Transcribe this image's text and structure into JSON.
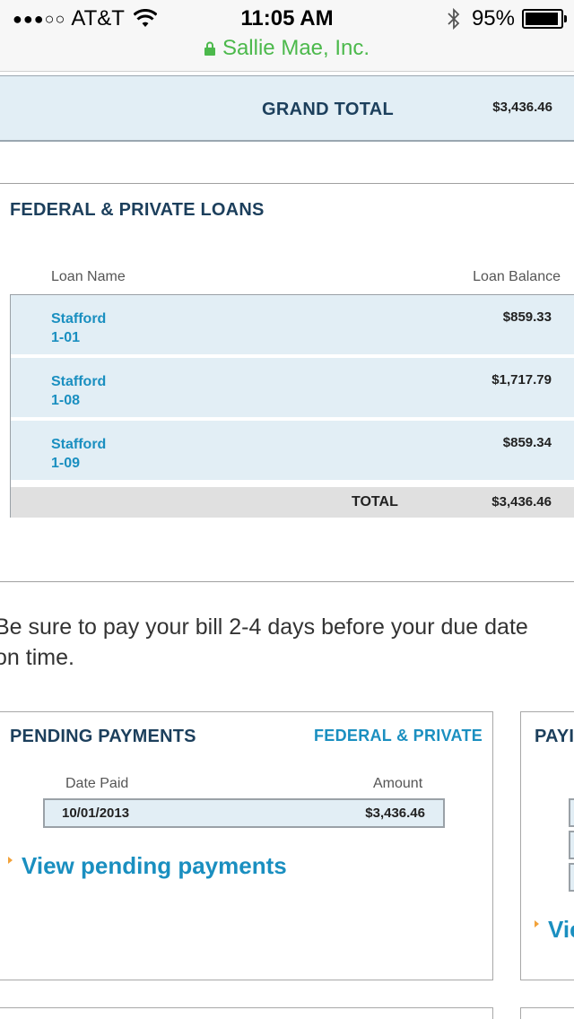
{
  "status_bar": {
    "carrier": "AT&T",
    "time": "11:05 AM",
    "battery": "95%",
    "battery_level": 0.95,
    "site": "Sallie Mae, Inc."
  },
  "grand_total": {
    "label": "GRAND TOTAL",
    "value": "$3,436.46"
  },
  "loans": {
    "title": "FEDERAL & PRIVATE LOANS",
    "columns": {
      "name": "Loan Name",
      "balance": "Loan Balance"
    },
    "rows": [
      {
        "name": "Stafford",
        "id": "1-01",
        "balance": "$859.33"
      },
      {
        "name": "Stafford",
        "id": "1-08",
        "balance": "$1,717.79"
      },
      {
        "name": "Stafford",
        "id": "1-09",
        "balance": "$859.34"
      }
    ],
    "total_label": "TOTAL",
    "total_value": "$3,436.46"
  },
  "notice": {
    "line1": "Be sure to pay your bill 2-4 days before your due date",
    "line2": "on time."
  },
  "pending": {
    "title": "PENDING PAYMENTS",
    "filter_link": "FEDERAL & PRIVATE",
    "columns": {
      "date": "Date Paid",
      "amount": "Amount"
    },
    "rows": [
      {
        "date": "10/01/2013",
        "amount": "$3,436.46"
      }
    ],
    "view_link": "View pending payments"
  },
  "right_card": {
    "title_partial": "PAYI",
    "link_partial": "Vie"
  },
  "colors": {
    "header_navy": "#1c3f5c",
    "link_blue": "#1a8fc0",
    "row_bg": "#e2eef5",
    "secure_green": "#4cb94c",
    "arrow_orange": "#f2a23a"
  },
  "icons": [
    "signal-dots-icon",
    "wifi-icon",
    "bluetooth-icon",
    "battery-icon",
    "lock-icon",
    "arrow-right-icon"
  ]
}
